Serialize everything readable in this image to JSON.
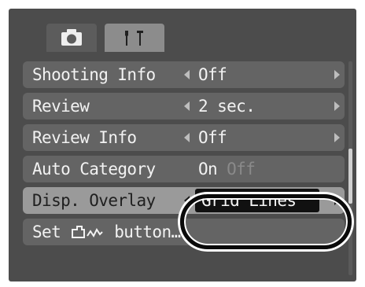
{
  "tabs": [
    {
      "icon": "camera-icon"
    },
    {
      "icon": "wrench-icon"
    }
  ],
  "menu": {
    "items": [
      {
        "label": "Shooting Info",
        "value": "Off"
      },
      {
        "label": "Review",
        "value": "2 sec."
      },
      {
        "label": "Review Info",
        "value": "Off"
      },
      {
        "label": "Auto Category",
        "value": "On",
        "value_alt": "Off"
      },
      {
        "label": "Disp. Overlay",
        "value": "Grid Lines"
      },
      {
        "label_prefix": "Set",
        "label_suffix": "button…",
        "icon": "print-share-icon"
      }
    ],
    "selected_index": 4
  },
  "scroll": {
    "position_fraction": 0.55
  },
  "colors": {
    "screen_bg": "#4c4c4c",
    "row_bg": "#646464",
    "selected_row_bg": "#9a9a9a",
    "value_highlight": "#111111"
  }
}
